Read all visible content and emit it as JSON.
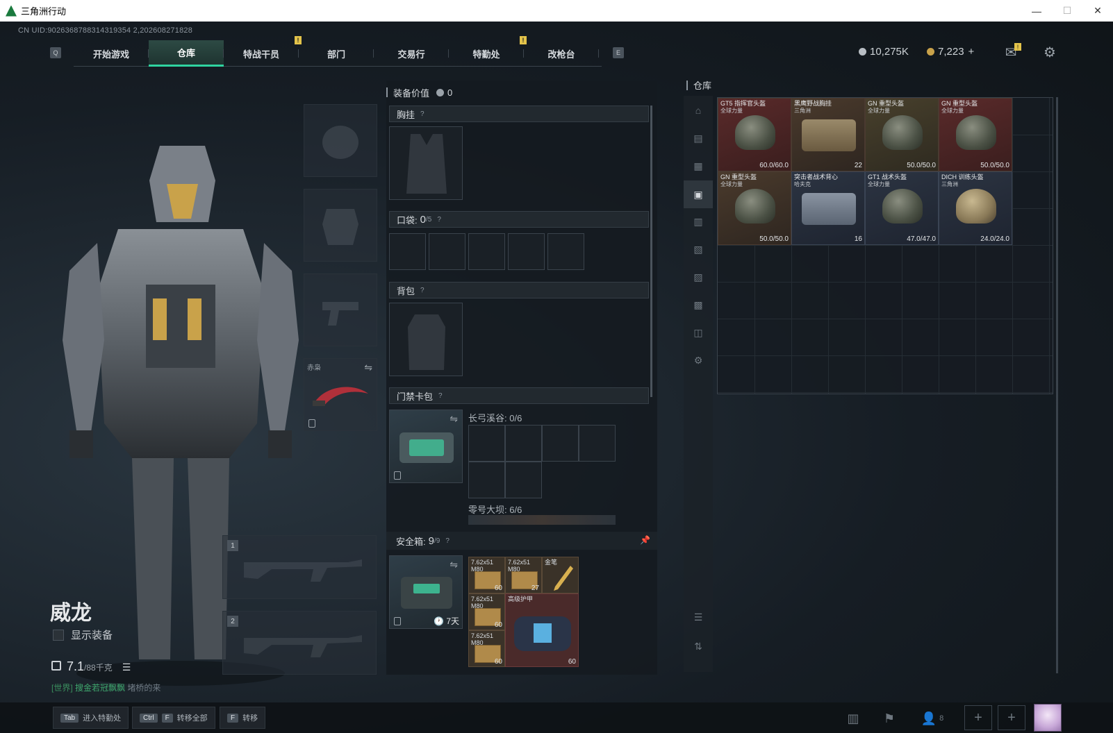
{
  "window": {
    "title": "三角洲行动",
    "controls": [
      "—",
      "☐",
      "✕"
    ]
  },
  "uid": "CN UID:9026368788314319354 2,202608271828",
  "nav": {
    "left_key": "Q",
    "right_key": "E",
    "tabs": [
      "开始游戏",
      "仓库",
      "特战干员",
      "部门",
      "交易行",
      "特勤处",
      "改枪台"
    ],
    "active": "仓库",
    "alert_mark": "!"
  },
  "currency": {
    "silver": "10,275K",
    "gold": "7,223",
    "gold_plus": "+",
    "silver_color": "#b8bec4",
    "gold_color": "#c9a24a"
  },
  "icons": {
    "mail": "mail-icon",
    "settings": "gear-icon",
    "mail_badge": "!"
  },
  "character": {
    "name": "威龙",
    "show_equipment_label": "显示装备",
    "weight": "7.1",
    "weight_sub": "/88千克"
  },
  "chat": {
    "channel": "[世界]",
    "name": "搜金若冠飘飘",
    "message": "堵桥的来"
  },
  "slots": {
    "melee_label": "赤枭",
    "weapon1": "1",
    "weapon2": "2"
  },
  "equipment": {
    "value_label": "装备价值",
    "value": "0",
    "chest_rig": "胸挂",
    "pockets": "口袋:",
    "pockets_count": "0",
    "pockets_max": "/5",
    "backpack": "背包",
    "keycard_bag": "门禁卡包",
    "q_mark": "?",
    "map1": "长弓溪谷: 0/6",
    "map2": "零号大坝: 6/6",
    "safebox": "安全箱:",
    "safebox_count": "9",
    "safebox_max": "/9",
    "safebox_days": "7天",
    "safe_items": [
      {
        "name": "7.62x51\nM80",
        "count": "60"
      },
      {
        "name": "7.62x51\nM80",
        "count": "27"
      },
      {
        "name": "金笔",
        "count": ""
      },
      {
        "name": "7.62x51\nM80",
        "count": "60"
      },
      {
        "name": "高级护甲",
        "count": "60"
      },
      {
        "name": "7.62x51\nM80",
        "count": "60"
      }
    ]
  },
  "warehouse": {
    "title": "仓库",
    "items": [
      {
        "name": "GT5 指挥官头盔",
        "sub": "全球力量",
        "value": "60.0/60.0",
        "kind": "helmet",
        "bg": "red"
      },
      {
        "name": "黑鹰野战胸挂",
        "sub": "三角洲",
        "value": "22",
        "kind": "vest",
        "bg": "brown"
      },
      {
        "name": "GN 重型头盔",
        "sub": "全球力量",
        "value": "50.0/50.0",
        "kind": "helmet",
        "bg": "olive"
      },
      {
        "name": "GN 重型头盔",
        "sub": "全球力量",
        "value": "50.0/50.0",
        "kind": "helmet",
        "bg": "red"
      },
      {
        "name": "GN 重型头盔",
        "sub": "全球力量",
        "value": "50.0/50.0",
        "kind": "helmet",
        "bg": "brown"
      },
      {
        "name": "突击者战术背心",
        "sub": "哈夫克",
        "value": "16",
        "kind": "vest-gray",
        "bg": "blue"
      },
      {
        "name": "GT1 战术头盔",
        "sub": "全球力量",
        "value": "47.0/47.0",
        "kind": "helmet",
        "bg": "blue"
      },
      {
        "name": "DICH 训练头盔",
        "sub": "三角洲",
        "value": "24.0/24.0",
        "kind": "helmet",
        "bg": "blue"
      }
    ]
  },
  "bottom": {
    "hint1_key": "Tab",
    "hint1": "进入特勤处",
    "hint2_key": "Ctrl",
    "hint2_key2": "F",
    "hint2": "转移全部",
    "hint3_key": "F",
    "hint3": "转移",
    "team_count": "8"
  }
}
